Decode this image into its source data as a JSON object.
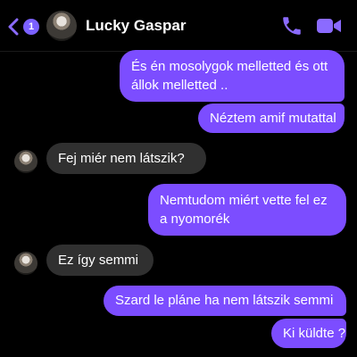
{
  "header": {
    "unread_count": "1",
    "contact_name": "Lucky Gaspar",
    "back_icon": "chevron-left-icon",
    "call_icon": "phone-icon",
    "video_icon": "video-camera-icon"
  },
  "messages": [
    {
      "direction": "outgoing",
      "line1": "És én mosolygok melletted és ott",
      "line2": "állok melletted .."
    },
    {
      "direction": "outgoing",
      "text": "Néztem amif mutattal"
    },
    {
      "direction": "incoming",
      "text": "Fej miér nem látszik?"
    },
    {
      "direction": "outgoing",
      "line1": "Nemtudom miért vette fel ez",
      "line2": "a nyomorék"
    },
    {
      "direction": "incoming",
      "text": "Ez így semmi"
    },
    {
      "direction": "outgoing",
      "text": "Szard le pláne ha nem látszik semmi"
    },
    {
      "direction": "outgoing",
      "text": "Ki küldte ?"
    }
  ],
  "colors": {
    "accent": "#7c4dff",
    "incoming_bubble": "#303030",
    "background": "#000000"
  }
}
